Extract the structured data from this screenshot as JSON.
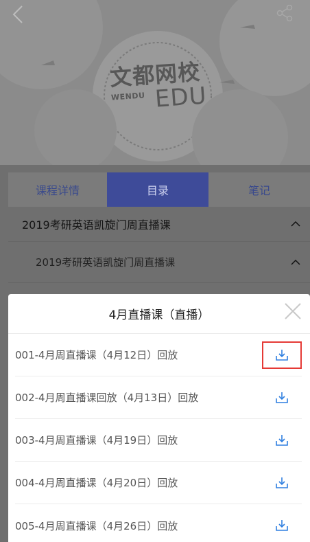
{
  "header": {
    "back_icon": "chevron-left-icon",
    "share_icon": "share-icon",
    "logo_cn": "文都网校",
    "logo_en": "EDU",
    "logo_sub": "WENDU"
  },
  "tabs": [
    {
      "label": "课程详情",
      "active": false
    },
    {
      "label": "目录",
      "active": true
    },
    {
      "label": "笔记",
      "active": false
    }
  ],
  "catalog": {
    "course": "2019考研英语凯旋门周直播课",
    "section": "2019考研英语凯旋门周直播课"
  },
  "popup": {
    "title": "4月直播课（直播）",
    "close_icon": "close-icon",
    "lessons": [
      {
        "title": "001-4月周直播课（4月12日）回放",
        "highlighted": true
      },
      {
        "title": "002-4月周直播课回放（4月13日）回放",
        "highlighted": false
      },
      {
        "title": "003-4月周直播课（4月19日）回放",
        "highlighted": false
      },
      {
        "title": "004-4月周直播课（4月20日）回放",
        "highlighted": false
      },
      {
        "title": "005-4月周直播课（4月26日）回放",
        "highlighted": false
      }
    ]
  },
  "colors": {
    "accent_blue": "#2f7fe0",
    "highlight_red": "#e53935",
    "active_tab": "#3e4b99"
  }
}
